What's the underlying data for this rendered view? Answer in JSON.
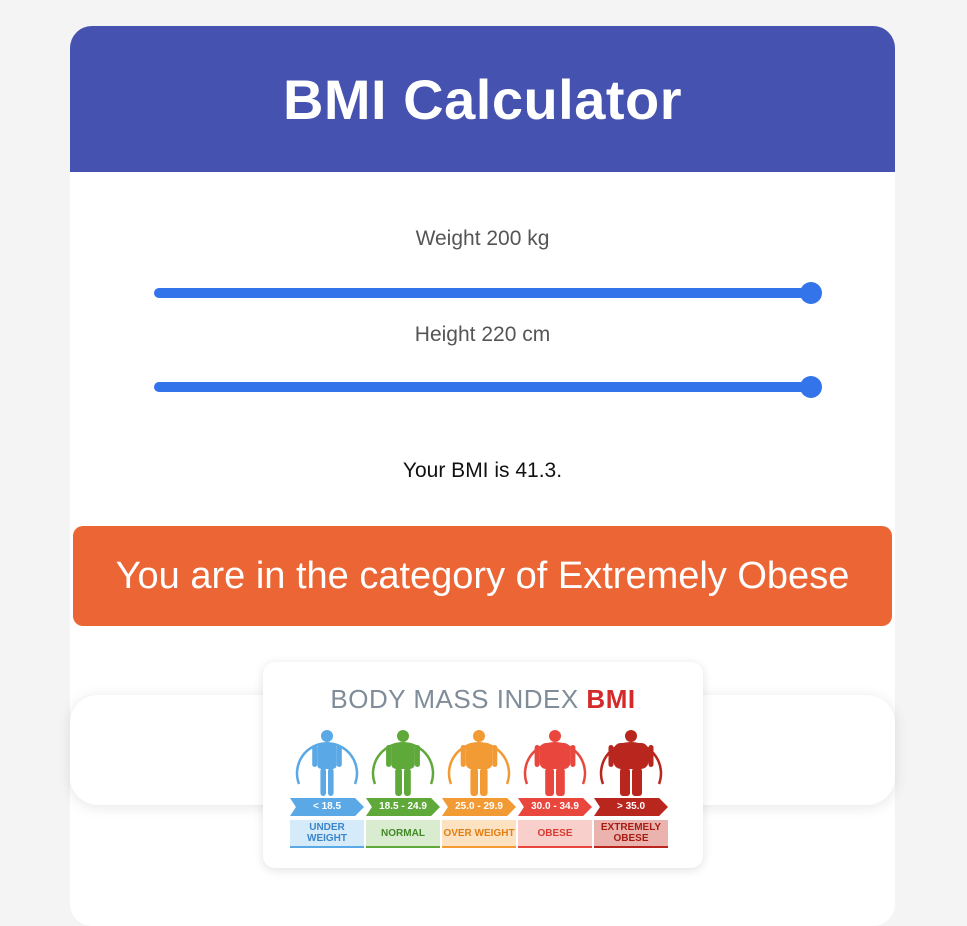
{
  "app": {
    "title": "BMI Calculator"
  },
  "weight": {
    "label": "Weight 200 kg",
    "fraction": 1.0
  },
  "height": {
    "label": "Height 220 cm",
    "fraction": 1.0
  },
  "result": {
    "text": "Your BMI is 41.3."
  },
  "category": {
    "text": "You are in the category of Extremely Obese",
    "color": "#ec6535"
  },
  "chart": {
    "title_main": "BODY MASS INDEX ",
    "title_accent": "BMI",
    "categories": [
      {
        "range": "< 18.5",
        "label": "UNDER WEIGHT",
        "color": "#5aa9e6",
        "light": "#d6ebfa",
        "text": "#3a86c8"
      },
      {
        "range": "18.5 - 24.9",
        "label": "NORMAL",
        "color": "#5fa83a",
        "light": "#d9ecd0",
        "text": "#3f8a24"
      },
      {
        "range": "25.0 - 29.9",
        "label": "OVER WEIGHT",
        "color": "#f29b35",
        "light": "#fde2c2",
        "text": "#e07f14"
      },
      {
        "range": "30.0 - 34.9",
        "label": "OBESE",
        "color": "#e9473e",
        "light": "#f8cfcb",
        "text": "#d93a31"
      },
      {
        "range": "> 35.0",
        "label": "EXTREMELY OBESE",
        "color": "#b8261e",
        "light": "#eab3ad",
        "text": "#a61c15"
      }
    ]
  },
  "theme": {
    "header": "#4552b0",
    "slider": "#3374ea"
  }
}
